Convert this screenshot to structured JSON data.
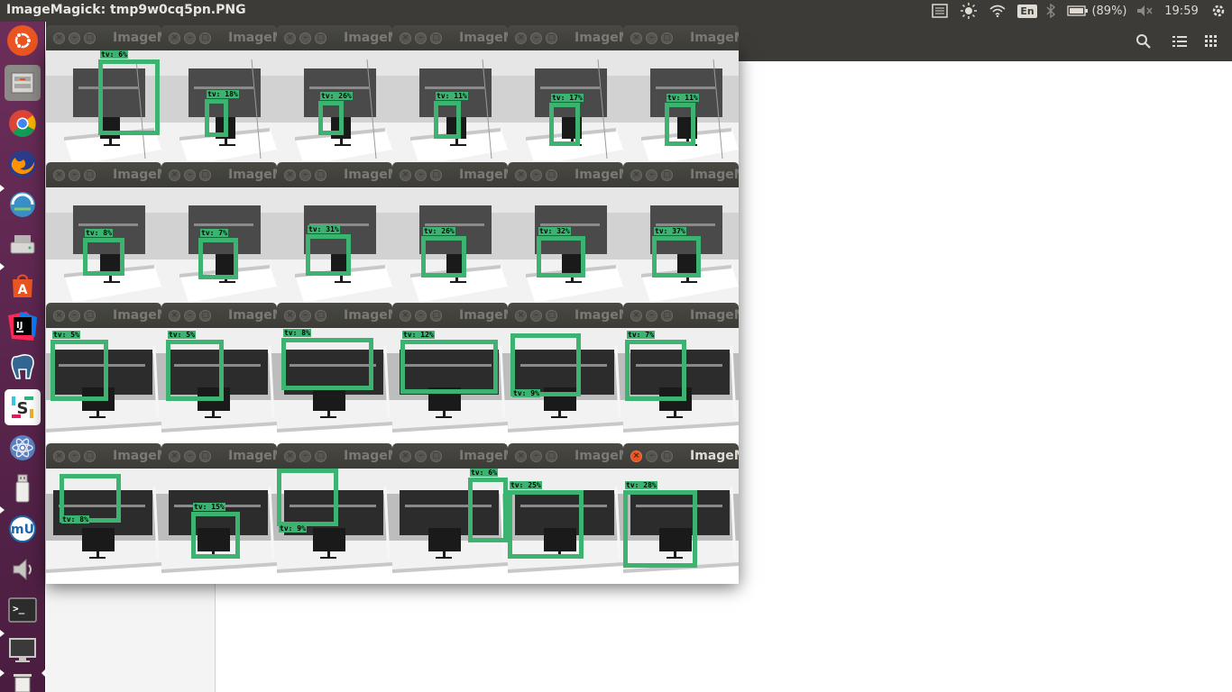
{
  "topbar": {
    "window_title": "ImageMagick: tmp9w0cq5pn.PNG",
    "keyboard": "En",
    "battery": "(89%)",
    "clock": "19:59"
  },
  "launcher": {
    "items": [
      "ubuntu-dash",
      "files",
      "chrome",
      "firefox",
      "network-browser",
      "disk-drive",
      "software-center",
      "intellij-idea",
      "pgadmin",
      "slack",
      "atom",
      "usb-drive",
      "musescore",
      "sound",
      "terminal",
      "monitor",
      "trash"
    ]
  },
  "image_window_title": "ImageMagick",
  "detections": [
    {
      "label": "tv: 6%"
    },
    {
      "label": "tv: 18%"
    },
    {
      "label": "tv: 26%"
    },
    {
      "label": "tv: 11%"
    },
    {
      "label": "tv: 17%"
    },
    {
      "label": "tv: 11%"
    },
    {
      "label": "tv: 8%"
    },
    {
      "label": "tv: 7%"
    },
    {
      "label": "tv: 31%"
    },
    {
      "label": "tv: 26%"
    },
    {
      "label": "tv: 32%"
    },
    {
      "label": "tv: 37%"
    },
    {
      "label": "tv: 5%"
    },
    {
      "label": "tv: 5%"
    },
    {
      "label": "tv: 8%"
    },
    {
      "label": "tv: 12%"
    },
    {
      "label": "tv: 9%"
    },
    {
      "label": "tv: 7%"
    },
    {
      "label": "tv: 8%"
    },
    {
      "label": "tv: 15%"
    },
    {
      "label": "tv: 9%"
    },
    {
      "label": "tv: 6%"
    },
    {
      "label": "tv: 25%"
    },
    {
      "label": "tv: 28%"
    }
  ],
  "detection_color": "#3cb371",
  "accent_close": "#e95420"
}
